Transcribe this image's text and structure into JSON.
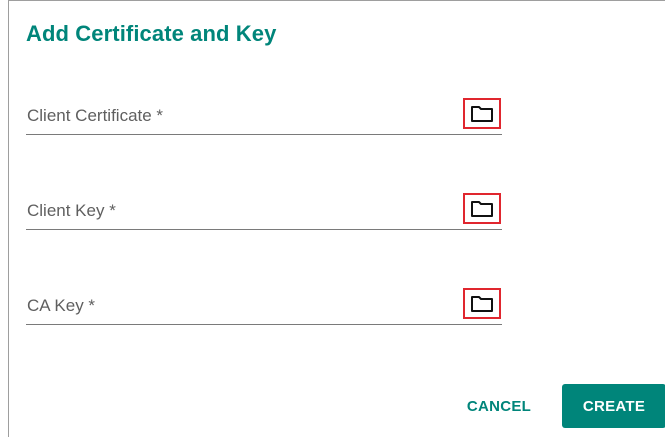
{
  "dialog": {
    "title": "Add Certificate and Key",
    "fields": [
      {
        "label": "Client Certificate *",
        "icon": "folder-icon"
      },
      {
        "label": "Client Key *",
        "icon": "folder-icon"
      },
      {
        "label": "CA Key *",
        "icon": "folder-icon"
      }
    ],
    "cancel_label": "CANCEL",
    "create_label": "CREATE"
  },
  "colors": {
    "accent": "#00857a",
    "highlight": "#e0262e",
    "label_text": "#5f5f5f"
  }
}
